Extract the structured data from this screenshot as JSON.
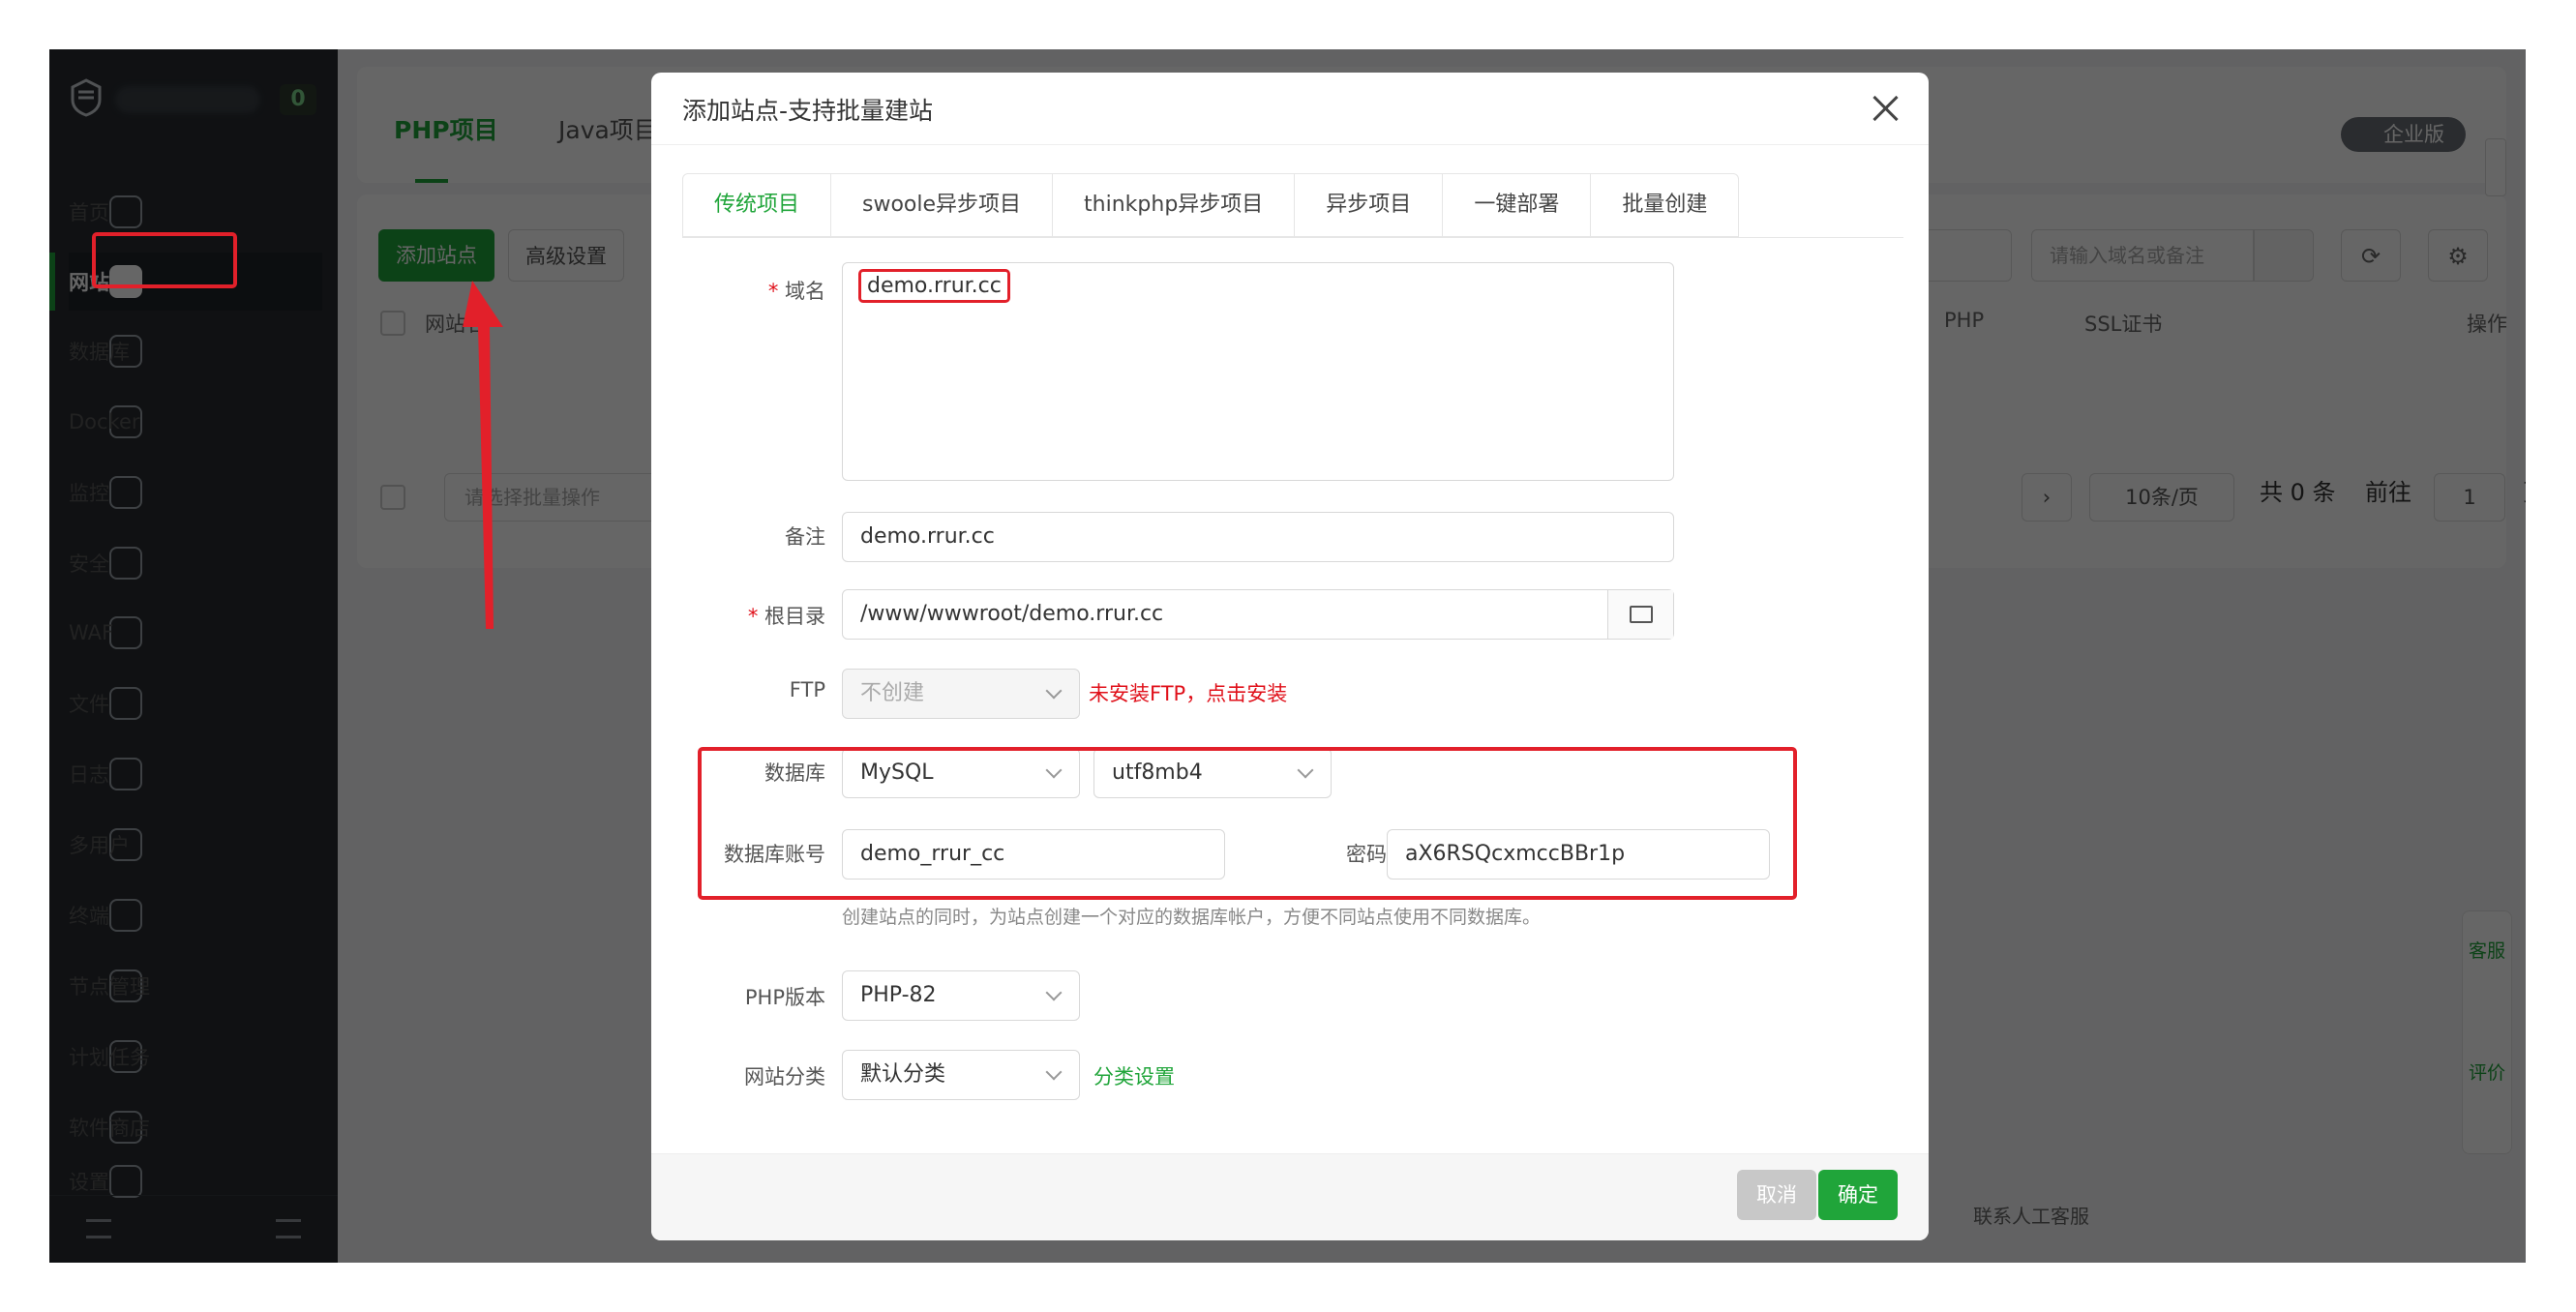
{
  "sidebar": {
    "badge": "0",
    "items": [
      {
        "label": "首页",
        "icon": "home-icon"
      },
      {
        "label": "网站",
        "icon": "website-icon"
      },
      {
        "label": "数据库",
        "icon": "database-icon"
      },
      {
        "label": "Docker",
        "icon": "docker-icon"
      },
      {
        "label": "监控",
        "icon": "monitor-icon"
      },
      {
        "label": "安全",
        "icon": "shield-icon"
      },
      {
        "label": "WAF",
        "icon": "waf-icon"
      },
      {
        "label": "文件",
        "icon": "folder-icon"
      },
      {
        "label": "日志",
        "icon": "log-icon"
      },
      {
        "label": "多用户",
        "icon": "users-icon"
      },
      {
        "label": "终端",
        "icon": "terminal-icon"
      },
      {
        "label": "节点管理",
        "icon": "node-icon"
      },
      {
        "label": "计划任务",
        "icon": "calendar-icon"
      },
      {
        "label": "软件商店",
        "icon": "store-icon"
      },
      {
        "label": "设置",
        "icon": "settings-icon"
      }
    ]
  },
  "header": {
    "tab_php": "PHP项目",
    "tab_java": "Java项目",
    "enterprise": "企业版"
  },
  "list": {
    "add_site": "添加站点",
    "advanced": "高级设置",
    "search_placeholder": "请输入域名或备注",
    "col_site": "网站名",
    "col_php": "PHP",
    "col_ssl": "SSL证书",
    "col_ops": "操作",
    "batch_placeholder": "请选择批量操作",
    "page_size": "10条/页",
    "total": "共 0 条",
    "goto": "前往",
    "page_num": "1",
    "page_unit": "页",
    "contact": "联系人工客服"
  },
  "float": {
    "service": "客服",
    "review": "评价"
  },
  "modal": {
    "title": "添加站点-支持批量建站",
    "tabs": [
      "传统项目",
      "swoole异步项目",
      "thinkphp异步项目",
      "异步项目",
      "一键部署",
      "批量创建"
    ],
    "domain_label": "域名",
    "domain_value": "demo.rrur.cc",
    "remark_label": "备注",
    "remark_value": "demo.rrur.cc",
    "root_label": "根目录",
    "root_value": "/www/wwwroot/demo.rrur.cc",
    "ftp_label": "FTP",
    "ftp_value": "不创建",
    "ftp_warning": "未安装FTP，点击安装",
    "db_label": "数据库",
    "db_type": "MySQL",
    "db_charset": "utf8mb4",
    "db_account_label": "数据库账号",
    "db_account": "demo_rrur_cc",
    "password_label": "密码",
    "password": "aX6RSQcxmccBBr1p",
    "db_hint": "创建站点的同时，为站点创建一个对应的数据库帐户，方便不同站点使用不同数据库。",
    "php_label": "PHP版本",
    "php_value": "PHP-82",
    "category_label": "网站分类",
    "category_value": "默认分类",
    "category_link": "分类设置",
    "cancel": "取消",
    "confirm": "确定"
  }
}
